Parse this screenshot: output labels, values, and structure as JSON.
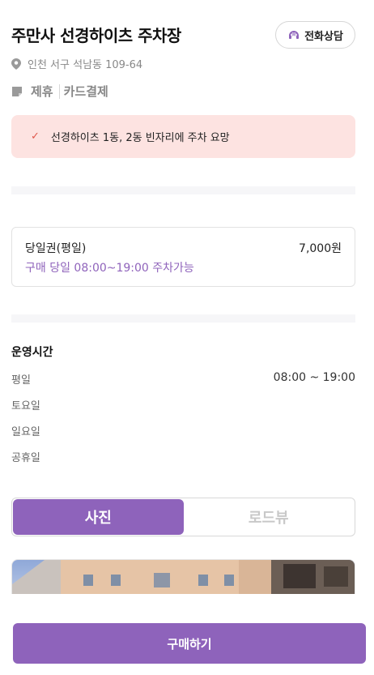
{
  "header": {
    "title": "주만사 선경하이츠 주차장",
    "call_label": "전화상담"
  },
  "address": "인천 서구 석남동 109-64",
  "tags": [
    "제휴",
    "카드결제"
  ],
  "notice": "선경하이츠 1동, 2동 빈자리에 주차 요망",
  "ticket": {
    "name": "당일권(평일)",
    "price": "7,000원",
    "hours": "구매 당일 08:00~19:00 주차가능"
  },
  "operating": {
    "title": "운영시간",
    "rows": [
      {
        "day": "평일",
        "time": "08:00 ~ 19:00"
      },
      {
        "day": "토요일",
        "time": ""
      },
      {
        "day": "일요일",
        "time": ""
      },
      {
        "day": "공휴일",
        "time": ""
      }
    ]
  },
  "segment": {
    "photo_label": "사진",
    "roadview_label": "로드뷰",
    "selected": "사진"
  },
  "buy_label": "구매하기",
  "colors": {
    "accent": "#8e63bb",
    "notice_bg": "#fde3e1",
    "check": "#e0584c"
  },
  "icons": {
    "call": "headset-icon",
    "address": "location-pin-icon",
    "tags": "card-tag-icon",
    "notice": "check-icon"
  }
}
